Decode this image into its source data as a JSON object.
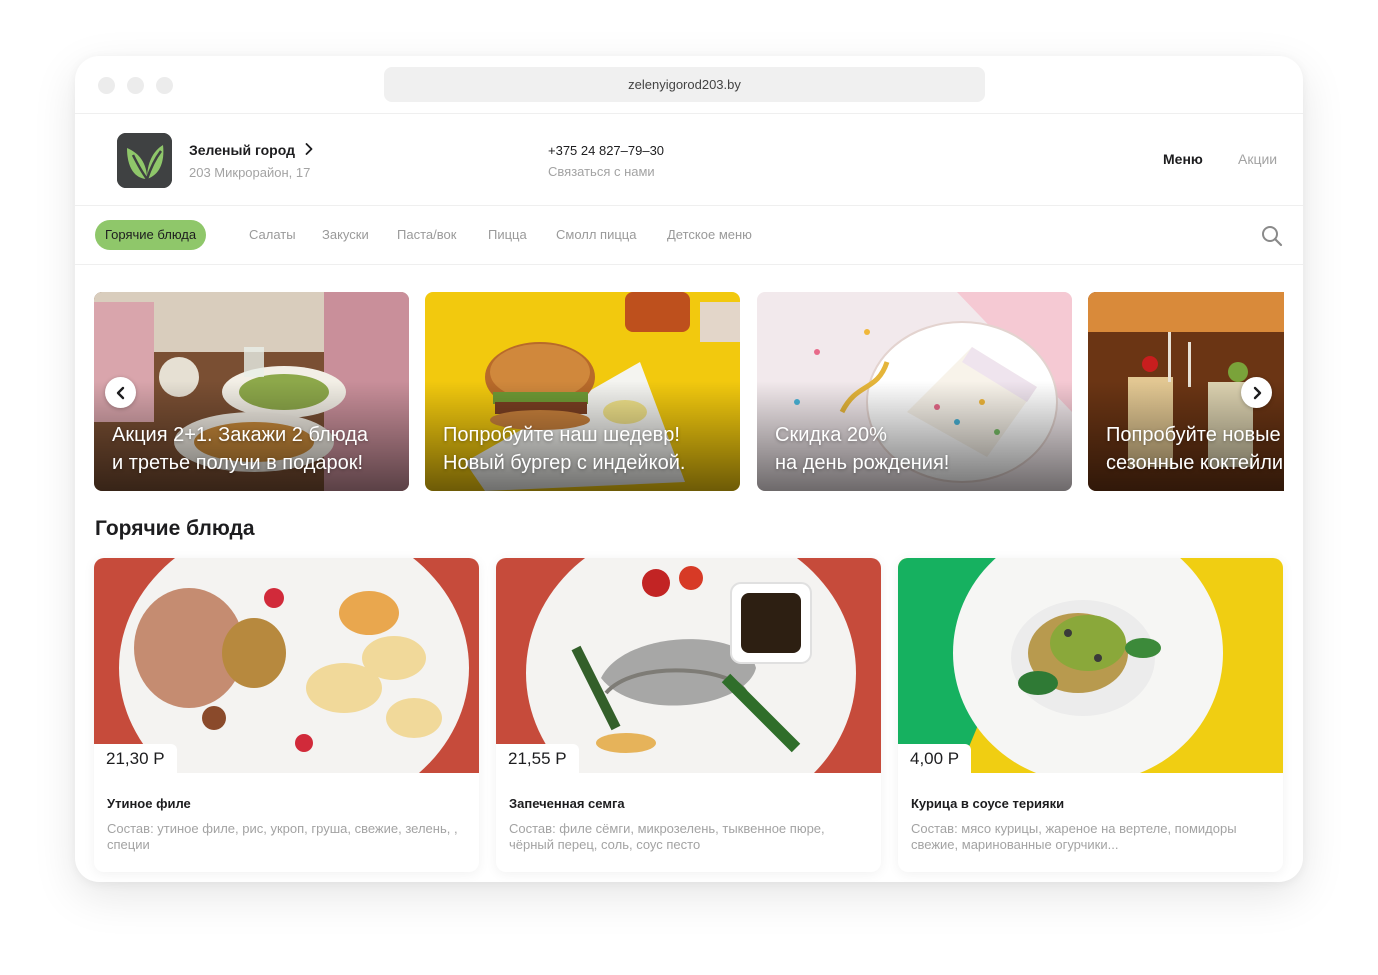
{
  "browser": {
    "url": "zelenyigorod203.by"
  },
  "header": {
    "brand_name": "Зеленый город",
    "brand_address": "203 Микрорайон, 17",
    "phone": "+375 24 827–79–30",
    "contact_label": "Связаться с нами",
    "nav": {
      "menu": "Меню",
      "promotions": "Акции"
    }
  },
  "categories": [
    {
      "label": "Горячие блюда",
      "active": true
    },
    {
      "label": "Салаты",
      "active": false
    },
    {
      "label": "Закуски",
      "active": false
    },
    {
      "label": "Паста/вок",
      "active": false
    },
    {
      "label": "Пицца",
      "active": false
    },
    {
      "label": "Смолл пицца",
      "active": false
    },
    {
      "label": "Детское меню",
      "active": false
    }
  ],
  "promos": [
    {
      "line1": "Акция 2+1. Закажи 2 блюда",
      "line2": "и третье получи в подарок!"
    },
    {
      "line1": "Попробуйте наш шедевр!",
      "line2": "Новый бургер с индейкой."
    },
    {
      "line1": "Скидка 20%",
      "line2": "на день рождения!"
    },
    {
      "line1": "Попробуйте новые",
      "line2": "сезонные коктейли"
    }
  ],
  "section_title": "Горячие блюда",
  "dishes": [
    {
      "price": "21,30 Р",
      "name": "Утиное филе",
      "description": "Состав: утиное филе, рис, укроп, груша, свежие, зелень, , специи"
    },
    {
      "price": "21,55 Р",
      "name": "Запеченная семга",
      "description": "Состав:  филе сёмги, микрозелень, тыквенное пюре, чёрный перец, соль, соус песто"
    },
    {
      "price": "4,00 Р",
      "name": "Курица в соусе терияки",
      "description": "Состав: мясо курицы, жареное на вертеле, помидоры свежие, маринованные огурчики..."
    }
  ],
  "colors": {
    "accent": "#8fc76a",
    "logo_bg": "#3f4142",
    "muted_text": "#a3a3a3"
  },
  "icons": {
    "search": "search-icon",
    "brand_chevron": "chevron-right-icon",
    "carousel_prev": "chevron-left-icon",
    "carousel_next": "chevron-right-icon",
    "logo": "leaf-logo-icon"
  }
}
